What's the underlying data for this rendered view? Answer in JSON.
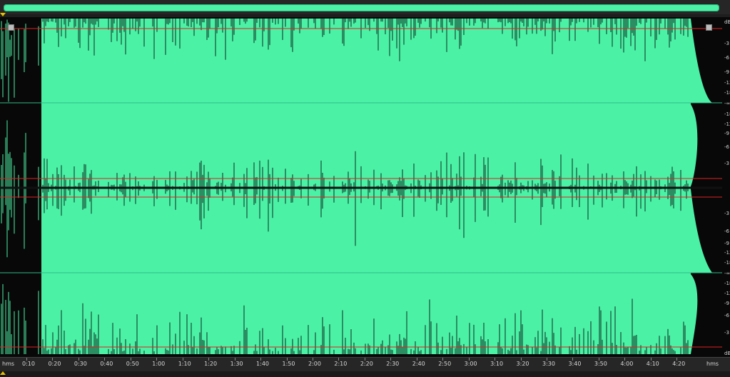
{
  "colors": {
    "waveform": "#4bf2a6",
    "background": "#080808",
    "scrollbar": "#4bf2a6",
    "clip_line": "#e02020",
    "play_marker": "#e6c000"
  },
  "timeline": {
    "unit_left": "hms",
    "unit_right": "hms",
    "ticks": [
      "0:10",
      "0:20",
      "0:30",
      "0:40",
      "0:50",
      "1:00",
      "1:10",
      "1:20",
      "1:30",
      "1:40",
      "1:50",
      "2:00",
      "2:10",
      "2:20",
      "2:30",
      "2:40",
      "2:50",
      "3:00",
      "3:10",
      "3:20",
      "3:30",
      "3:40",
      "3:50",
      "4:00",
      "4:10",
      "4:20"
    ]
  },
  "db_scale": {
    "top_unit": "dB",
    "bottom_unit": "dB",
    "channel1": [
      "-3",
      "-6",
      "-9",
      "-12",
      "-18",
      "-∞"
    ],
    "channel2_upper": [
      "-18",
      "-12",
      "-9",
      "-6",
      "-3"
    ],
    "channel2_lower": [
      "-3",
      "-6",
      "-9",
      "-12",
      "-18",
      "-∞"
    ],
    "channel3": [
      "-18",
      "-12",
      "-9",
      "-6",
      "-3"
    ]
  },
  "icons": {
    "scroll": "horizontal-scrollbar-thumb",
    "marker": "playhead-marker-icon",
    "fade_handle": "fade-handle-icon"
  }
}
